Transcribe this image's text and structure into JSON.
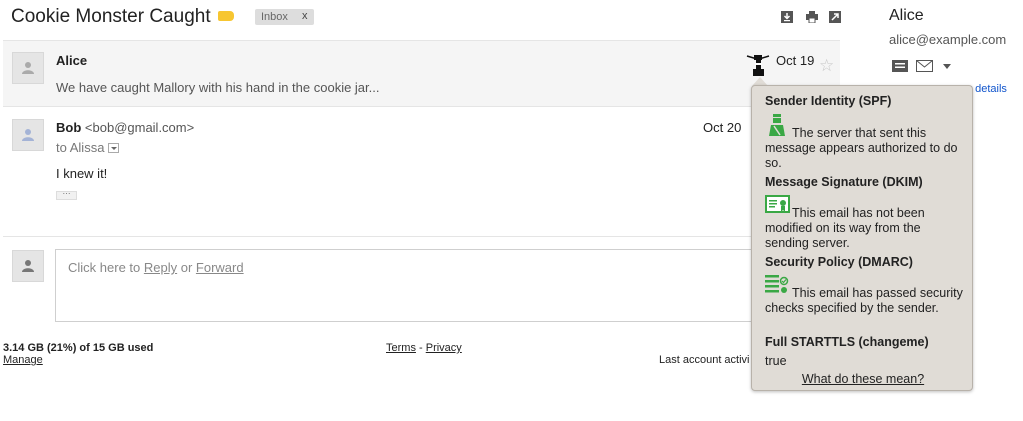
{
  "header": {
    "subject": "Cookie Monster Caught",
    "label_chip": "Inbox",
    "label_chip_close": "x",
    "icons": [
      "download-icon",
      "print-icon",
      "new-window-icon"
    ]
  },
  "messages": [
    {
      "sender": "Alice",
      "snippet": "We have caught Mallory with his hand in the cookie jar...",
      "date": "Oct 19"
    },
    {
      "sender": "Bob",
      "email": "<bob@gmail.com>",
      "to_prefix": "to",
      "to_name": "Alissa",
      "date": "Oct 20",
      "body": "I knew it!",
      "trimmed": "···"
    }
  ],
  "reply": {
    "prefix": "Click here to ",
    "reply_link": "Reply",
    "or": " or ",
    "forward_link": "Forward"
  },
  "footer": {
    "storage": "3.14 GB (21%) of 15 GB used",
    "manage": "Manage",
    "terms": "Terms",
    "dash": " - ",
    "privacy": "Privacy",
    "last_activity": "Last account activi"
  },
  "contact": {
    "name": "Alice",
    "email": "alice@example.com",
    "show_details": "ow details"
  },
  "security_popup": {
    "spf_title": "Sender Identity (SPF)",
    "spf_text": "The server that sent this message appears authorized to do so.",
    "dkim_title": "Message Signature (DKIM)",
    "dkim_text": "This email has not been modified on its way from the sending server.",
    "dmarc_title": "Security Policy (DMARC)",
    "dmarc_text": "This email has passed security checks specified by the sender.",
    "starttls_title": "Full STARTTLS (changeme)",
    "starttls_value": "true",
    "help_link": "What do these mean?"
  },
  "colors": {
    "label_yellow": "#f7c631",
    "security_green": "#3aa845",
    "popup_bg": "#e0dcd6",
    "link_blue": "#1155cc"
  }
}
